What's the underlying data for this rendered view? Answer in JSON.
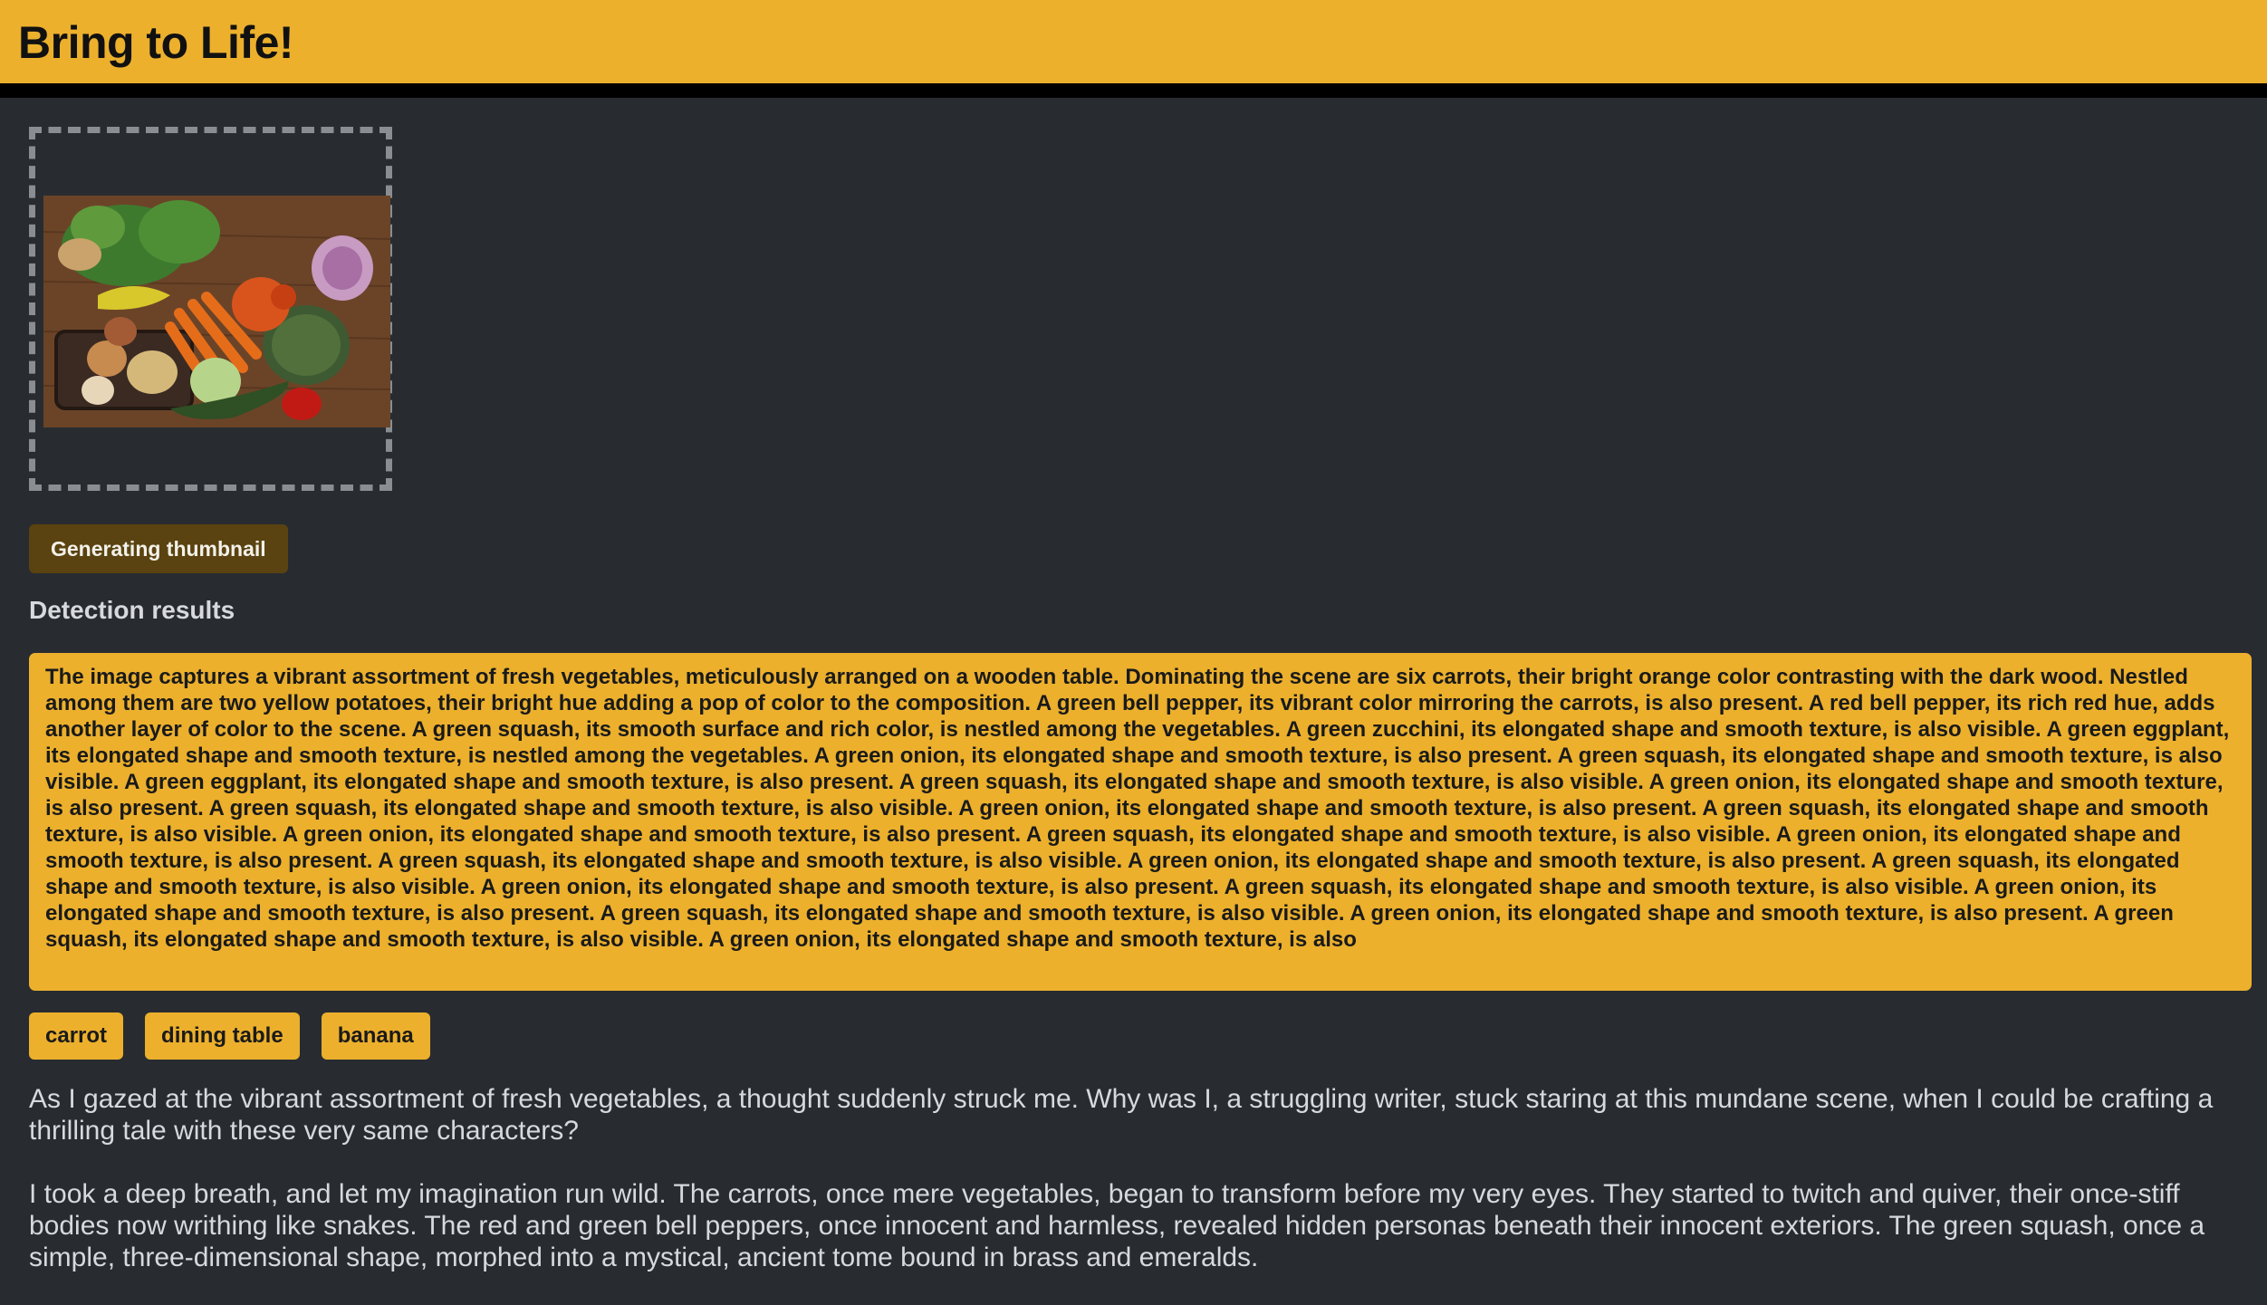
{
  "header": {
    "title": "Bring to Life!"
  },
  "upload": {
    "image_alt": "vegetables-photo"
  },
  "status": {
    "label": "Generating thumbnail"
  },
  "detection": {
    "title": "Detection results",
    "description": "The image captures a vibrant assortment of fresh vegetables, meticulously arranged on a wooden table. Dominating the scene are six carrots, their bright orange color contrasting with the dark wood. Nestled among them are two yellow potatoes, their bright hue adding a pop of color to the composition. A green bell pepper, its vibrant color mirroring the carrots, is also present. A red bell pepper, its rich red hue, adds another layer of color to the scene. A green squash, its smooth surface and rich color, is nestled among the vegetables. A green zucchini, its elongated shape and smooth texture, is also visible. A green eggplant, its elongated shape and smooth texture, is nestled among the vegetables. A green onion, its elongated shape and smooth texture, is also present. A green squash, its elongated shape and smooth texture, is also visible. A green eggplant, its elongated shape and smooth texture, is also present. A green squash, its elongated shape and smooth texture, is also visible. A green onion, its elongated shape and smooth texture, is also present. A green squash, its elongated shape and smooth texture, is also visible. A green onion, its elongated shape and smooth texture, is also present. A green squash, its elongated shape and smooth texture, is also visible. A green onion, its elongated shape and smooth texture, is also present. A green squash, its elongated shape and smooth texture, is also visible. A green onion, its elongated shape and smooth texture, is also present. A green squash, its elongated shape and smooth texture, is also visible. A green onion, its elongated shape and smooth texture, is also present. A green squash, its elongated shape and smooth texture, is also visible. A green onion, its elongated shape and smooth texture, is also present. A green squash, its elongated shape and smooth texture, is also visible. A green onion, its elongated shape and smooth texture, is also present. A green squash, its elongated shape and smooth texture, is also visible. A green onion, its elongated shape and smooth texture, is also present. A green squash, its elongated shape and smooth texture, is also visible. A green onion, its elongated shape and smooth texture, is also",
    "tags": [
      "carrot",
      "dining table",
      "banana"
    ]
  },
  "story": {
    "paragraphs": [
      "As I gazed at the vibrant assortment of fresh vegetables, a thought suddenly struck me. Why was I, a struggling writer, stuck staring at this mundane scene, when I could be crafting a thrilling tale with these very same characters?",
      "I took a deep breath, and let my imagination run wild. The carrots, once mere vegetables, began to transform before my very eyes. They started to twitch and quiver, their once-stiff bodies now writhing like snakes. The red and green bell peppers, once innocent and harmless, revealed hidden personas beneath their innocent exteriors. The green squash, once a simple, three-dimensional shape, morphed into a mystical, ancient tome bound in brass and emeralds."
    ]
  },
  "colors": {
    "accent": "#ecb02d",
    "background": "#282c31",
    "header_border": "#000000",
    "status_button": "#5a4310",
    "text_light": "#d7d9dc"
  }
}
